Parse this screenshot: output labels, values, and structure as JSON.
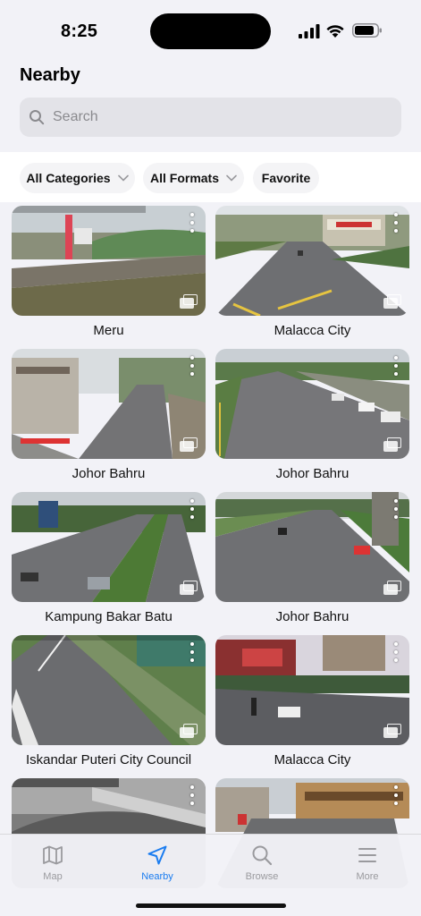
{
  "status": {
    "time": "8:25"
  },
  "header": {
    "title": "Nearby"
  },
  "search": {
    "placeholder": "Search"
  },
  "filters": {
    "categories": "All Categories",
    "formats": "All Formats",
    "favorite": "Favorite"
  },
  "cameras": [
    {
      "name": "Meru"
    },
    {
      "name": "Malacca City"
    },
    {
      "name": "Johor Bahru"
    },
    {
      "name": "Johor Bahru"
    },
    {
      "name": "Kampung Bakar Batu"
    },
    {
      "name": "Johor Bahru"
    },
    {
      "name": "Iskandar Puteri City Council"
    },
    {
      "name": "Malacca City"
    },
    {
      "name": ""
    },
    {
      "name": ""
    }
  ],
  "tabs": [
    {
      "label": "Map",
      "icon": "map-icon"
    },
    {
      "label": "Nearby",
      "icon": "location-arrow-icon"
    },
    {
      "label": "Browse",
      "icon": "search-icon"
    },
    {
      "label": "More",
      "icon": "menu-icon"
    }
  ],
  "colors": {
    "accent": "#1a7cf0"
  }
}
